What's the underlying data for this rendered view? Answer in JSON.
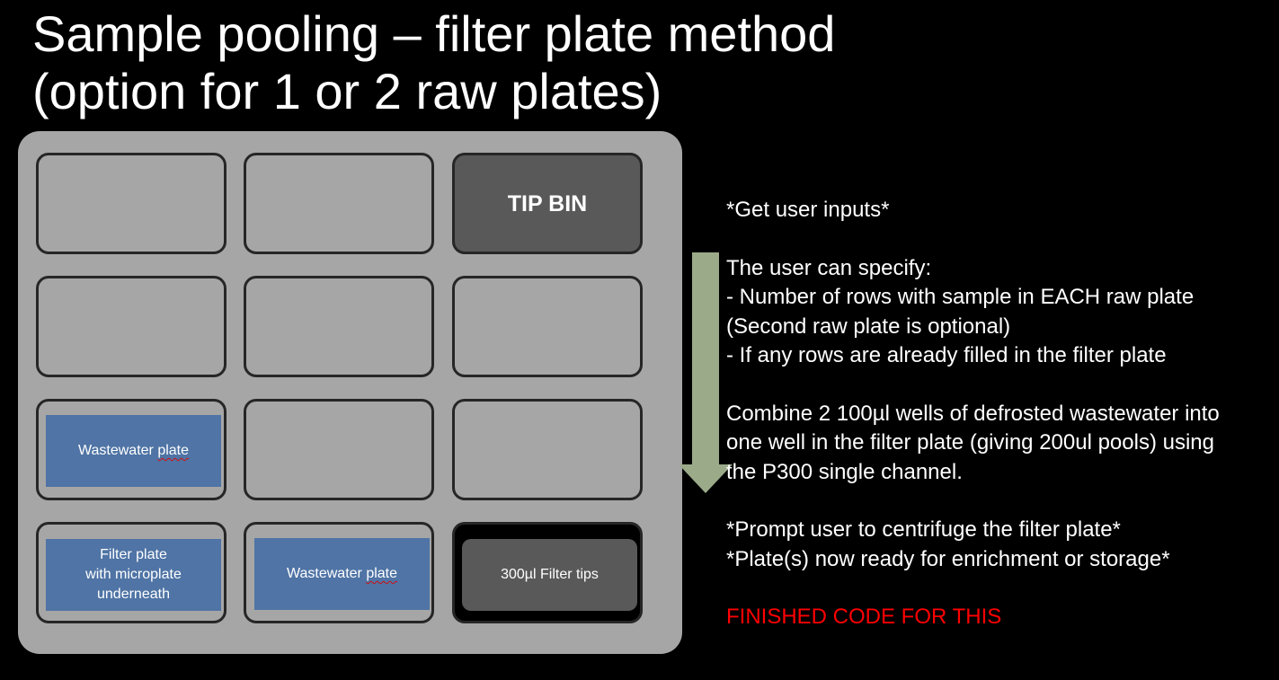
{
  "title": {
    "line1": "Sample pooling – filter plate method",
    "line2": "(option for 1 or 2 raw plates)"
  },
  "deck": {
    "tip_bin_label": "TIP BIN",
    "wastewater_plate_label_1": {
      "prefix": "Wastewater ",
      "underlined": "plate"
    },
    "filter_plate_label": "Filter plate\nwith microplate\nunderneath",
    "wastewater_plate_label_2": {
      "prefix": "Wastewater ",
      "underlined": "plate"
    },
    "filter_tips_label": "300µl Filter tips"
  },
  "description": {
    "lines": [
      "*Get user inputs*",
      "",
      "The user can specify:",
      "- Number of rows with sample in EACH raw plate",
      "(Second raw plate is optional)",
      "- If any rows are already filled in the filter plate",
      "",
      "Combine 2 100µl wells of defrosted wastewater into",
      "one well in the filter plate (giving 200ul pools) using",
      "the P300 single channel.",
      "",
      "*Prompt user to centrifuge the filter plate*",
      "*Plate(s) now ready for enrichment or storage*",
      ""
    ],
    "status": "FINISHED CODE FOR THIS"
  },
  "colors": {
    "background": "#000000",
    "deck": "#a6a6a6",
    "slot_border": "#262626",
    "tip_bin": "#595959",
    "labware_blue": "#4f74a5",
    "arrow": "#9bab8a",
    "status_red": "#ff0000"
  }
}
